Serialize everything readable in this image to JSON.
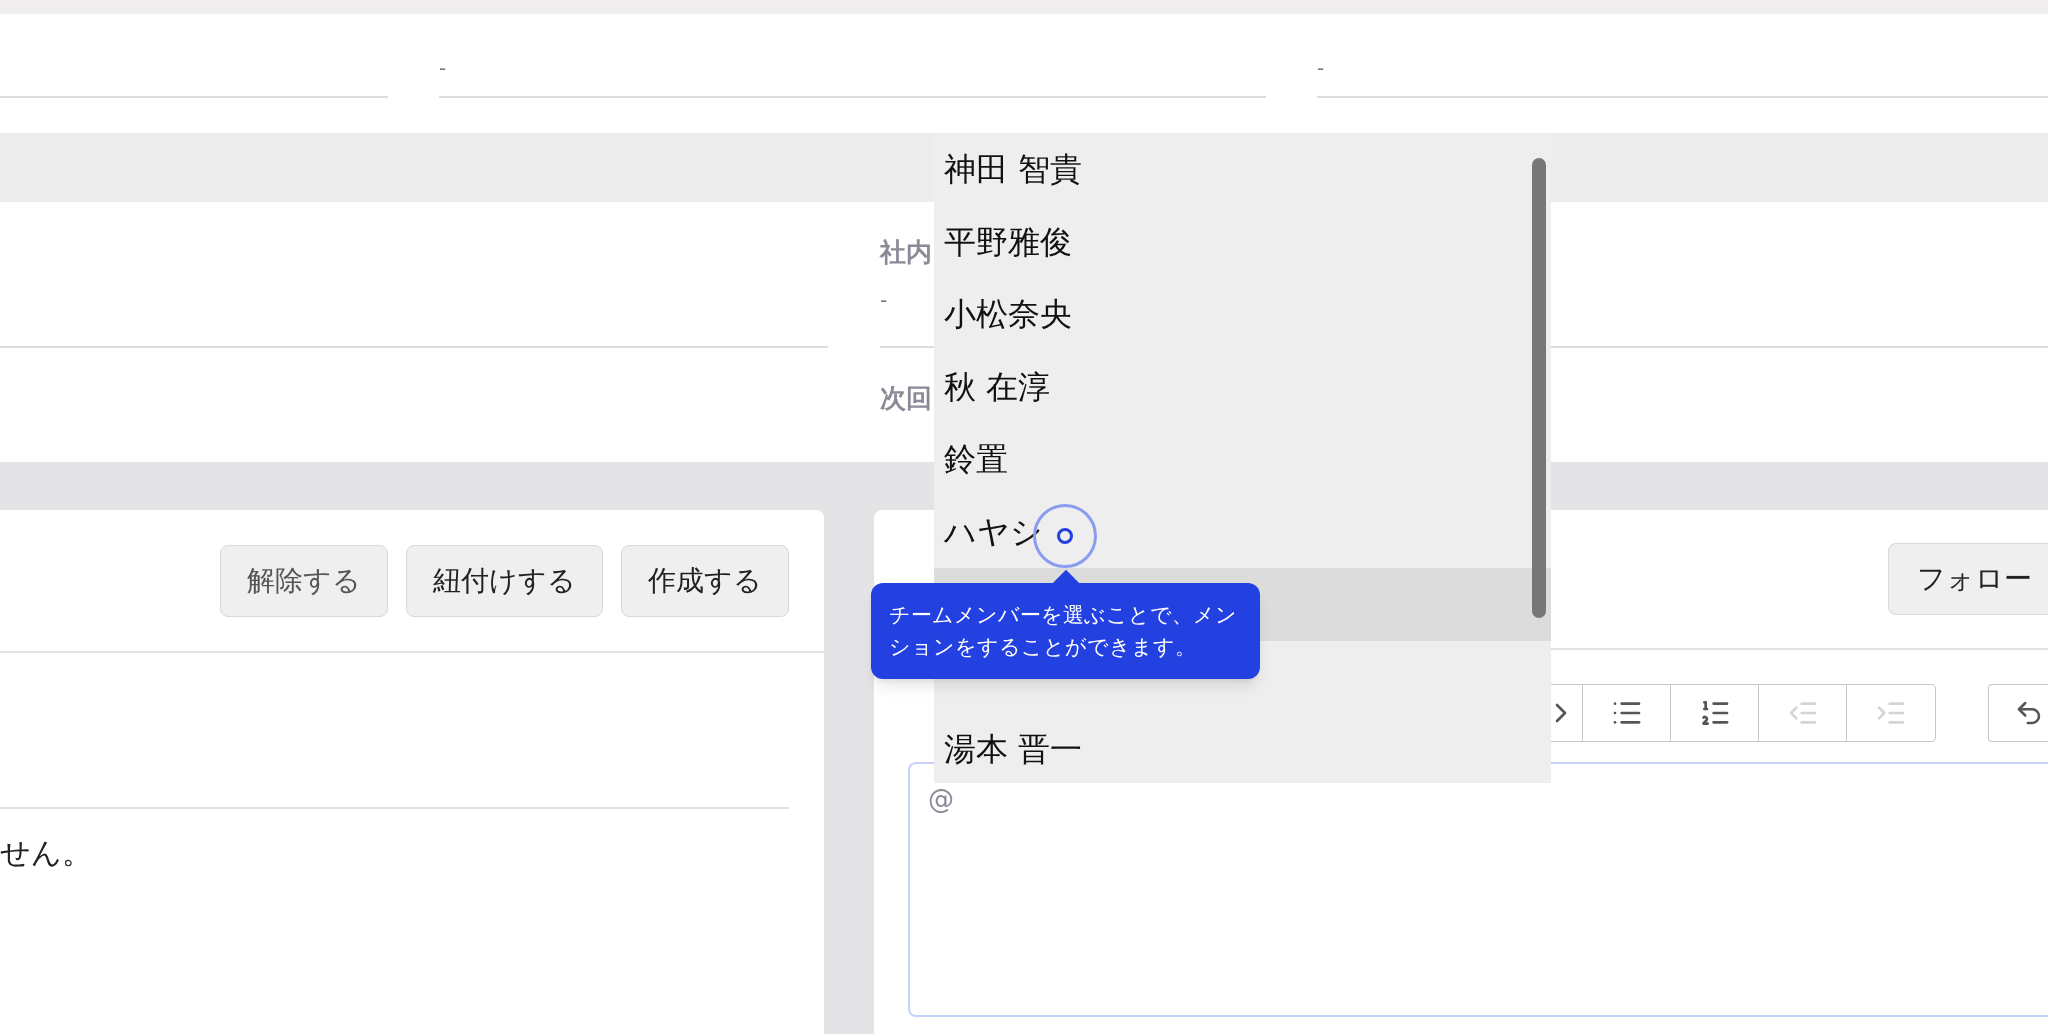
{
  "top_fields": [
    {
      "value": "-"
    },
    {
      "value": "-"
    }
  ],
  "info": {
    "fields": [
      {
        "label": "社内",
        "value": "-"
      },
      {
        "label": "次回"
      }
    ]
  },
  "left_card": {
    "buttons": [
      "解除する",
      "紐付けする",
      "作成する"
    ],
    "empty_text": "せん。"
  },
  "right_card": {
    "follow_button": "フォロー",
    "toolbar": [
      {
        "kind": "chevron",
        "disabled": false
      },
      {
        "kind": "bullets",
        "disabled": false
      },
      {
        "kind": "numbered",
        "disabled": false
      },
      {
        "kind": "outdent",
        "disabled": true
      },
      {
        "kind": "indent",
        "disabled": true
      },
      {
        "kind": "undo",
        "disabled": false
      }
    ],
    "editor": {
      "value": "@"
    }
  },
  "mention_menu": {
    "items": [
      {
        "name": "神田 智貴",
        "selected": false
      },
      {
        "name": "平野雅俊",
        "selected": false
      },
      {
        "name": "小松奈央",
        "selected": false
      },
      {
        "name": "秋 在淳",
        "selected": false
      },
      {
        "name": "鈴置",
        "selected": false
      },
      {
        "name": "ハヤシ",
        "selected": false
      },
      {
        "selected": true
      },
      {
        "selected": false
      },
      {
        "name": "湯本 晋一",
        "selected": false
      }
    ]
  },
  "tooltip": {
    "text": "チームメンバーを選ぶことで、メンションをすることができます。"
  }
}
